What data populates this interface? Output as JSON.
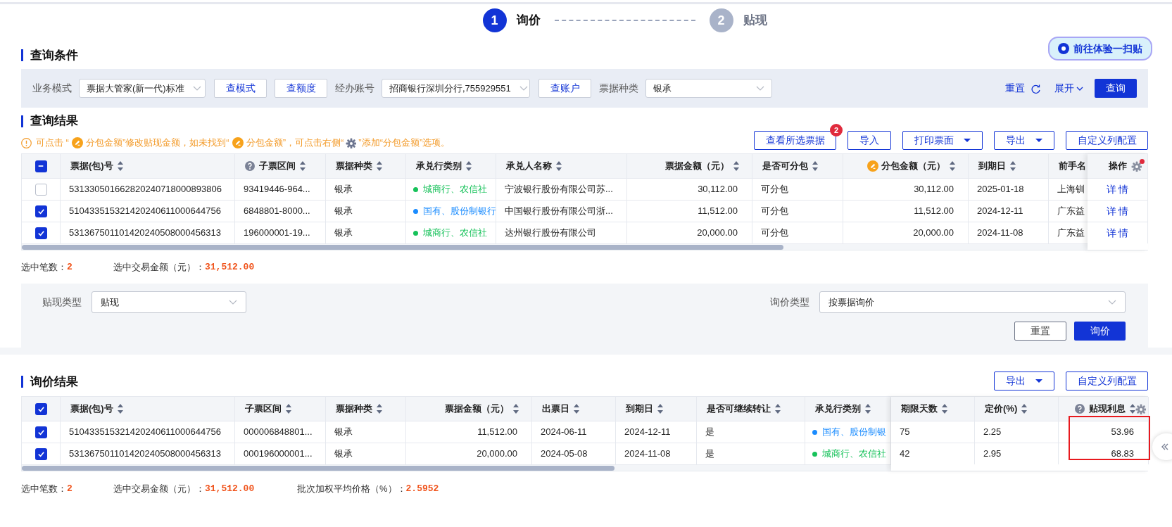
{
  "steps": [
    {
      "number": "1",
      "label": "询价",
      "selected": true
    },
    {
      "number": "2",
      "label": "贴现",
      "selected": false
    }
  ],
  "query": {
    "title": "查询条件",
    "promo": "前往体验一扫贴",
    "filters": [
      {
        "kind": "select",
        "label": "业务模式",
        "value": "票据大管家(新一代)标准"
      },
      {
        "kind": "button",
        "label": "查模式"
      },
      {
        "kind": "button",
        "label": "查额度"
      },
      {
        "kind": "select",
        "label": "经办账号",
        "value": "招商银行深圳分行,755929551"
      },
      {
        "kind": "button",
        "label": "查账户"
      },
      {
        "kind": "select",
        "label": "票据种类",
        "value": "银承"
      }
    ],
    "reset": "重置",
    "expand": "展开",
    "submit": "查询"
  },
  "results": {
    "title": "查询结果",
    "notice": [
      {
        "kind": "warning"
      },
      {
        "kind": "text",
        "text": "可点击 “"
      },
      {
        "kind": "pen"
      },
      {
        "kind": "text",
        "text": "分包金额”修改贴现金额，如未找到“"
      },
      {
        "kind": "pen"
      },
      {
        "kind": "text",
        "text": "分包金额”，可点击右侧“"
      },
      {
        "kind": "gear"
      },
      {
        "kind": "text",
        "text": "”添加“分包金额”选项。"
      }
    ],
    "buttons": [
      {
        "label": "查看所选票据",
        "badge": "2",
        "dropdown": false
      },
      {
        "label": "导入",
        "dropdown": false
      },
      {
        "label": "打印票面",
        "dropdown": true
      },
      {
        "label": "导出",
        "dropdown": true
      },
      {
        "label": "自定义列配置",
        "dropdown": false
      }
    ],
    "table": {
      "partly_checked": true,
      "settings_alert": true,
      "columns": [
        {
          "label": "票据(包)号",
          "kind": "text",
          "sortable": true
        },
        {
          "label": "子票区间",
          "kind": "text",
          "sortable": true,
          "hint": true
        },
        {
          "label": "票据种类",
          "kind": "text",
          "sortable": true
        },
        {
          "label": "承兑行类别",
          "kind": "text",
          "sortable": true
        },
        {
          "label": "承兑人名称",
          "kind": "text",
          "sortable": true
        },
        {
          "label": "票据金额（元）",
          "kind": "amount",
          "sortable": true
        },
        {
          "label": "是否可分包",
          "kind": "text",
          "sortable": true
        },
        {
          "label": "分包金额（元）",
          "kind": "amount",
          "sortable": true,
          "editable": true
        },
        {
          "label": "到期日",
          "kind": "text",
          "sortable": true
        },
        {
          "label": "前手名",
          "kind": "text",
          "sortable": false
        },
        {
          "label": "操作",
          "kind": "action",
          "fixed": true,
          "sortable": false
        }
      ],
      "rows": [
        {
          "selected": false,
          "cells": [
            "531330501662820240718000893806",
            "93419446-964...",
            "银承",
            {
              "text": "城商行、农信社",
              "color": "#17c25a"
            },
            "宁波银行股份有限公司苏...",
            "30,112.00",
            "可分包",
            "30,112.00",
            "2025-01-18",
            "上海钏",
            "详 情"
          ]
        },
        {
          "selected": true,
          "cells": [
            "510433515321420240611000644756",
            "6848801-8000...",
            "银承",
            {
              "text": "国有、股份制银行",
              "color": "#1a8cff"
            },
            "中国银行股份有限公司浙...",
            "11,512.00",
            "可分包",
            "11,512.00",
            "2024-12-11",
            "广东益",
            "详 情"
          ]
        },
        {
          "selected": true,
          "cells": [
            "531367501101420240508000456313",
            "196000001-19...",
            "银承",
            {
              "text": "城商行、农信社",
              "color": "#17c25a"
            },
            "达州银行股份有限公司",
            "20,000.00",
            "可分包",
            "20,000.00",
            "2024-11-08",
            "广东益",
            "详 情"
          ]
        }
      ]
    },
    "summary": [
      {
        "label": "选中笔数：",
        "value": "2"
      },
      {
        "label": "选中交易金额（元）：",
        "value": "31,512.00"
      }
    ]
  },
  "form": {
    "fields": [
      {
        "label": "贴现类型",
        "value": "贴现"
      },
      {
        "label": "询价类型",
        "value": "按票据询价"
      }
    ],
    "reset": "重置",
    "submit": "询价"
  },
  "quotes": {
    "title": "询价结果",
    "buttons": [
      {
        "label": "导出",
        "dropdown": true
      },
      {
        "label": "自定义列配置",
        "dropdown": false
      }
    ],
    "table": {
      "all_checked": true,
      "settings_alert": false,
      "columns": [
        {
          "label": "票据(包)号",
          "kind": "text",
          "sortable": true
        },
        {
          "label": "子票区间",
          "kind": "text",
          "sortable": true
        },
        {
          "label": "票据种类",
          "kind": "text",
          "sortable": true
        },
        {
          "label": "票据金额（元）",
          "kind": "amount",
          "sortable": true
        },
        {
          "label": "出票日",
          "kind": "text",
          "sortable": true
        },
        {
          "label": "到期日",
          "kind": "text",
          "sortable": true
        },
        {
          "label": "是否可继续转让",
          "kind": "text",
          "sortable": true
        },
        {
          "label": "承兑行类别",
          "kind": "text",
          "sortable": true
        },
        {
          "label": "期限天数",
          "kind": "text",
          "sortable": true,
          "fixed": true
        },
        {
          "label": "定价(%)",
          "kind": "text",
          "sortable": true,
          "fixed": true
        },
        {
          "label": "贴现利息",
          "kind": "amount",
          "sortable": true,
          "fixed": true,
          "hint": true,
          "highlighted": true
        }
      ],
      "rows": [
        {
          "selected": true,
          "cells": [
            "510433515321420240611000644756",
            "000006848801...",
            "银承",
            "11,512.00",
            "2024-06-11",
            "2024-12-11",
            "是",
            {
              "text": "国有、股份制银",
              "color": "#1a8cff"
            },
            "75",
            "2.25",
            "53.96"
          ]
        },
        {
          "selected": true,
          "cells": [
            "531367501101420240508000456313",
            "000196000001...",
            "银承",
            "20,000.00",
            "2024-05-08",
            "2024-11-08",
            "是",
            {
              "text": "城商行、农信社",
              "color": "#17c25a"
            },
            "42",
            "2.95",
            "68.83"
          ]
        }
      ]
    },
    "summary": [
      {
        "label": "选中笔数：",
        "value": "2"
      },
      {
        "label": "选中交易金额（元）：",
        "value": "31,512.00"
      },
      {
        "label": "批次加权平均价格（%）：",
        "value": "2.5952"
      }
    ]
  }
}
